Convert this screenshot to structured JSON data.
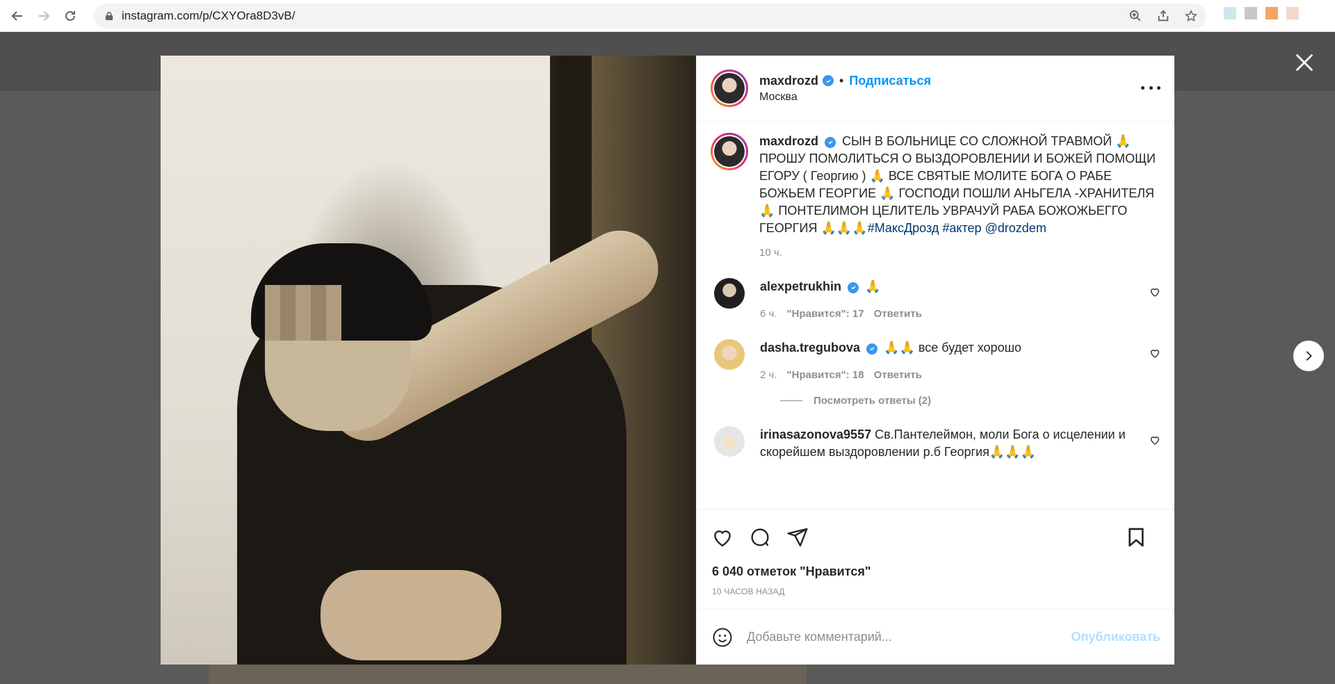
{
  "browser": {
    "url": "instagram.com/p/CXYOra8D3vB/",
    "icons": [
      "back-icon",
      "forward-icon",
      "reload-icon",
      "lock-icon",
      "zoom-icon",
      "share-icon",
      "star-icon"
    ]
  },
  "post": {
    "username": "maxdrozd",
    "follow_label": "Подписаться",
    "dot": "•",
    "location": "Москва",
    "caption": {
      "username": "maxdrozd",
      "text": "СЫН В БОЛЬНИЦЕ СО СЛОЖНОЙ ТРАВМОЙ 🙏 ПРОШУ ПОМОЛИТЬСЯ О ВЫЗДОРОВЛЕНИИ И БОЖЕЙ ПОМОЩИ ЕГОРУ ( Георгию ) 🙏 ВСЕ СВЯТЫЕ МОЛИТЕ БОГА О РАБЕ БОЖЬЕМ ГЕОРГИЕ 🙏 ГОСПОДИ ПОШЛИ АНЬГЕЛА -ХРАНИТЕЛЯ 🙏 ПОНТЕЛИМОН ЦЕЛИТЕЛЬ УВРАЧУЙ РАБА БОЖОЖЬЕГГО ГЕОРГИЯ 🙏🙏🙏",
      "hashtags": "#МаксДрозд #актер @drozdem",
      "time": "10 ч."
    },
    "comments": [
      {
        "username": "alexpetrukhin",
        "verified": true,
        "text": "🙏",
        "time": "6 ч.",
        "likes": "\"Нравится\": 17",
        "reply": "Ответить"
      },
      {
        "username": "dasha.tregubova",
        "verified": true,
        "text": "🙏🙏 все будет хорошо",
        "time": "2 ч.",
        "likes": "\"Нравится\": 18",
        "reply": "Ответить"
      },
      {
        "username": "irinasazonova9557",
        "verified": false,
        "text": "Св.Пантелеймон, моли Бога о исцелении и скорейшем выздоровлении р.б Георгия🙏🙏🙏"
      }
    ],
    "view_replies": "Посмотреть ответы (2)",
    "likes_count": "6 040 отметок \"Нравится\"",
    "posted_ago": "10 ЧАСОВ НАЗАД",
    "comment_placeholder": "Добавьте комментарий...",
    "publish_label": "Опубликовать"
  },
  "colors": {
    "accent": "#0095f6",
    "verified": "#3897f0",
    "hashtag": "#00376b",
    "muted": "#8e8e8e"
  }
}
